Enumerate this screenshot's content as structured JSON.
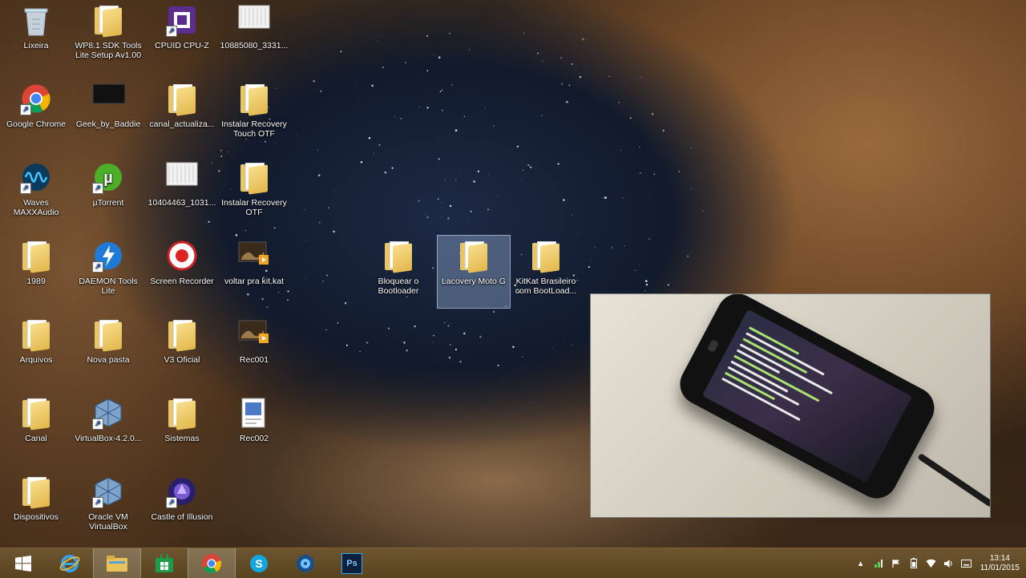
{
  "desktop": {
    "icons": [
      {
        "label": "Lixeira",
        "kind": "recycle"
      },
      {
        "label": "WP8.1 SDK Tools Lite Setup Av1.00",
        "kind": "folder"
      },
      {
        "label": "CPUID CPU-Z",
        "kind": "cpuz"
      },
      {
        "label": "10885080_3331...",
        "kind": "image"
      },
      {
        "label": "Google Chrome",
        "kind": "chrome"
      },
      {
        "label": "Geek_by_Baddie",
        "kind": "dark-image"
      },
      {
        "label": "canal_actualiza...",
        "kind": "folder"
      },
      {
        "label": "Instalar Recovery Touch OTF",
        "kind": "folder"
      },
      {
        "label": "Waves MAXXAudio",
        "kind": "waves"
      },
      {
        "label": "µTorrent",
        "kind": "utorrent"
      },
      {
        "label": "10404463_1031...",
        "kind": "image"
      },
      {
        "label": "Instalar Recovery OTF",
        "kind": "folder"
      },
      {
        "label": "1989",
        "kind": "folder"
      },
      {
        "label": "DAEMON Tools Lite",
        "kind": "daemon"
      },
      {
        "label": "Screen Recorder",
        "kind": "recorder"
      },
      {
        "label": "voltar pra kit.kat",
        "kind": "video"
      },
      {
        "label": "Bloquear o Bootloader",
        "kind": "folder"
      },
      {
        "label": "Lacovery Moto G",
        "kind": "folder",
        "selected": true
      },
      {
        "label": "KitKat Brasileiro com BootLoad...",
        "kind": "folder"
      },
      {
        "label": "Arquivos",
        "kind": "folder"
      },
      {
        "label": "Nova pasta",
        "kind": "folder"
      },
      {
        "label": "V3 Oficial",
        "kind": "folder"
      },
      {
        "label": "Rec001",
        "kind": "video"
      },
      {
        "label": "Canal",
        "kind": "folder"
      },
      {
        "label": "VirtualBox-4.2.0...",
        "kind": "virtualbox"
      },
      {
        "label": "Sistemas",
        "kind": "folder"
      },
      {
        "label": "Rec002",
        "kind": "doc"
      },
      {
        "label": "Dispositivos",
        "kind": "folder"
      },
      {
        "label": "Oracle VM VirtualBox",
        "kind": "virtualbox"
      },
      {
        "label": "Castle of Illusion",
        "kind": "castle"
      }
    ]
  },
  "taskbar": {
    "start_icon": "windows-start-icon",
    "apps": [
      {
        "name": "ie-icon",
        "active": false
      },
      {
        "name": "file-explorer-icon",
        "active": true
      },
      {
        "name": "store-icon",
        "active": false
      },
      {
        "name": "chrome-icon",
        "active": true
      },
      {
        "name": "skype-icon",
        "active": false
      },
      {
        "name": "media-icon",
        "active": false
      },
      {
        "name": "photoshop-icon",
        "active": false
      }
    ],
    "photoshop_label": "Ps"
  },
  "tray": {
    "time": "13:14",
    "date": "11/01/2015"
  },
  "colors": {
    "taskbar": "#5f4a26",
    "folder": "#e7c56a",
    "selection": "#a0bee6"
  }
}
